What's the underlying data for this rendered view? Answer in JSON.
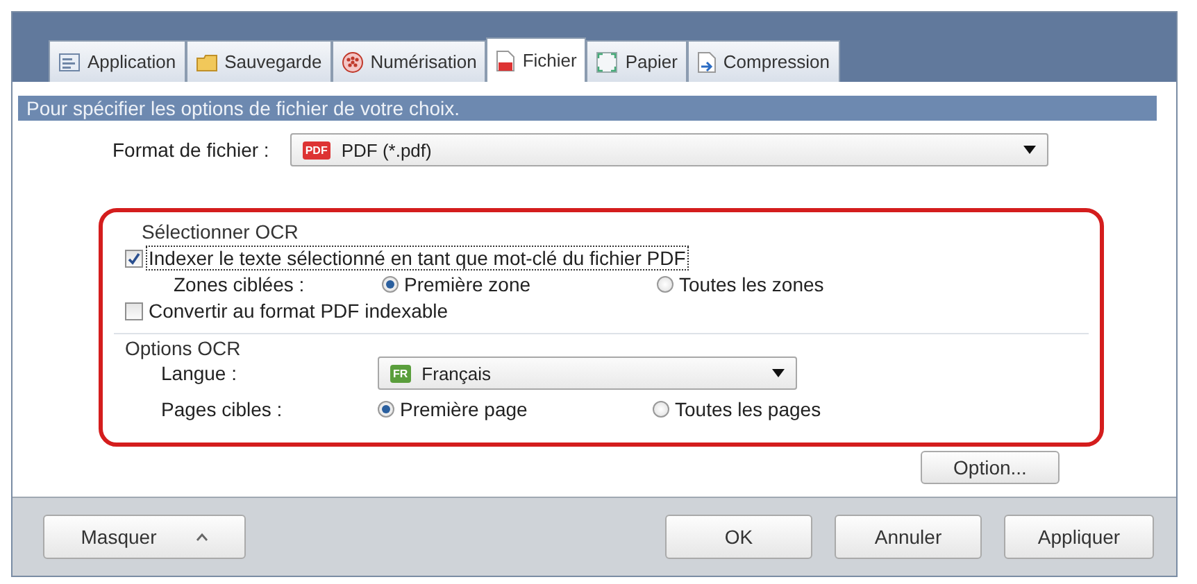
{
  "tabs": [
    {
      "label": "Application",
      "kind": "app",
      "selected": false
    },
    {
      "label": "Sauvegarde",
      "kind": "save",
      "selected": false
    },
    {
      "label": "Numérisation",
      "kind": "scan",
      "selected": false
    },
    {
      "label": "Fichier",
      "kind": "file",
      "selected": true
    },
    {
      "label": "Papier",
      "kind": "paper",
      "selected": false
    },
    {
      "label": "Compression",
      "kind": "compress",
      "selected": false
    }
  ],
  "banner": "Pour spécifier les options de fichier de votre choix.",
  "file_format": {
    "label": "Format de fichier :",
    "value": "PDF (*.pdf)",
    "badge": "PDF"
  },
  "ocr_selection": {
    "title": "Sélectionner OCR",
    "index_checkbox": {
      "label": "Indexer le texte sélectionné en tant que mot-clé du fichier PDF",
      "checked": true
    },
    "zones": {
      "label": "Zones ciblées :",
      "options": [
        {
          "label": "Première zone",
          "selected": true
        },
        {
          "label": "Toutes les zones",
          "selected": false
        }
      ]
    },
    "convert_checkbox": {
      "label": "Convertir au format PDF indexable",
      "checked": false
    }
  },
  "ocr_options": {
    "title": "Options OCR",
    "language": {
      "label": "Langue :",
      "value": "Français",
      "badge": "FR"
    },
    "pages": {
      "label": "Pages cibles :",
      "options": [
        {
          "label": "Première page",
          "selected": true
        },
        {
          "label": "Toutes les pages",
          "selected": false
        }
      ]
    }
  },
  "option_button": "Option...",
  "footer": {
    "left_button": "Masquer",
    "buttons": [
      "OK",
      "Annuler",
      "Appliquer"
    ]
  }
}
